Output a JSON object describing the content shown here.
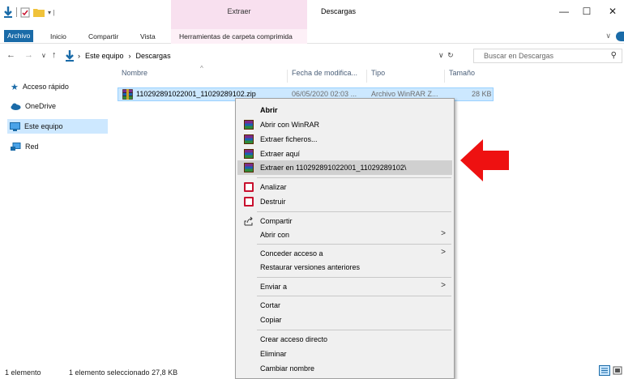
{
  "titlebar": {
    "context_tab": "Extraer",
    "window_title": "Descargas",
    "minimize": "—",
    "maximize": "☐",
    "close": "✕"
  },
  "ribbon": {
    "tabs": [
      "Archivo",
      "Inicio",
      "Compartir",
      "Vista",
      "Herramientas de carpeta comprimida"
    ],
    "collapse": "∨"
  },
  "address": {
    "crumbs": [
      "Este equipo",
      "Descargas"
    ],
    "separator": "›",
    "refresh": "↻",
    "dropdown": "∨",
    "search_placeholder": "Buscar en Descargas"
  },
  "sidebar": {
    "items": [
      "Acceso rápido",
      "OneDrive",
      "Este equipo",
      "Red"
    ]
  },
  "columns": [
    "Nombre",
    "Fecha de modifica...",
    "Tipo",
    "Tamaño"
  ],
  "file": {
    "name": "110292891022001_11029289102.zip",
    "date": "06/05/2020 02:03 ...",
    "type": "Archivo WinRAR Z...",
    "size": "28 KB"
  },
  "menu": {
    "items": [
      "Abrir",
      "Abrir con WinRAR",
      "Extraer ficheros...",
      "Extraer aquí",
      "Extraer en 110292891022001_11029289102\\",
      "Analizar",
      "Destruir",
      "Compartir",
      "Abrir con",
      "Conceder acceso a",
      "Restaurar versiones anteriores",
      "Enviar a",
      "Cortar",
      "Copiar",
      "Crear acceso directo",
      "Eliminar",
      "Cambiar nombre"
    ],
    "submenu_arrow": ">"
  },
  "status": {
    "count": "1 elemento",
    "selection": "1 elemento seleccionado  27,8 KB"
  },
  "colors": {
    "accent": "#1a6ba8",
    "selection": "#cce8ff",
    "context_tab": "#f8e0ef",
    "arrow": "#ee1111"
  }
}
